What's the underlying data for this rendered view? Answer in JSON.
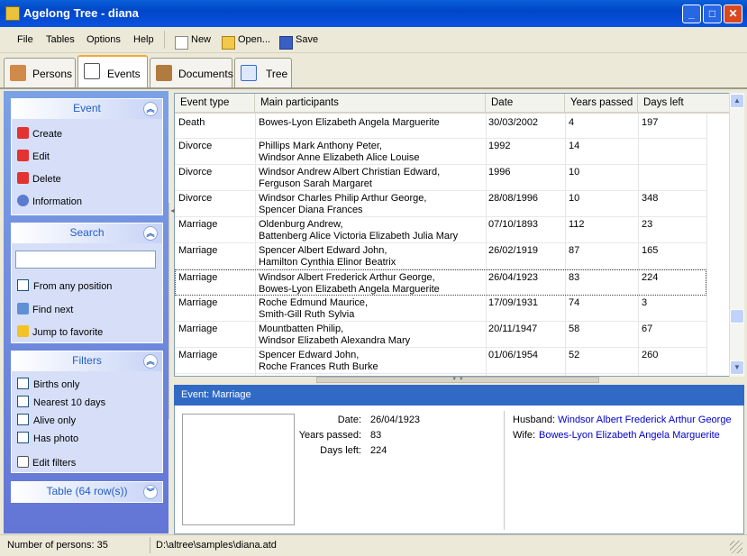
{
  "window": {
    "title": "Agelong Tree - diana",
    "minimize": "_",
    "maximize": "□",
    "close": "✕"
  },
  "menu": {
    "file": "File",
    "tables": "Tables",
    "options": "Options",
    "help": "Help"
  },
  "toolbar": {
    "new": "New",
    "open": "Open...",
    "save": "Save"
  },
  "tabs": {
    "persons": "Persons",
    "events": "Events",
    "documents": "Documents",
    "tree": "Tree"
  },
  "sidebar": {
    "event": {
      "title": "Event",
      "create": "Create",
      "edit": "Edit",
      "delete": "Delete",
      "information": "Information"
    },
    "search": {
      "title": "Search",
      "input_value": "",
      "from_any_position": "From any position",
      "find_next": "Find next",
      "jump_to_favorite": "Jump to favorite"
    },
    "filters": {
      "title": "Filters",
      "births_only": "Births only",
      "nearest_10_days": "Nearest 10 days",
      "alive_only": "Alive only",
      "has_photo": "Has photo",
      "edit_filters": "Edit filters"
    },
    "table": {
      "title": "Table (64 row(s))"
    }
  },
  "grid": {
    "columns": [
      "Event type",
      "Main participants",
      "Date",
      "Years passed",
      "Days left"
    ],
    "rows": [
      {
        "type": "Death",
        "p1": "Bowes-Lyon Elizabeth Angela Marguerite",
        "p2": "",
        "date": "30/03/2002",
        "years": "4",
        "days": "197"
      },
      {
        "type": "Divorce",
        "p1": "Phillips Mark Anthony Peter,",
        "p2": "Windsor Anne Elizabeth Alice Louise",
        "date": "1992",
        "years": "14",
        "days": ""
      },
      {
        "type": "Divorce",
        "p1": "Windsor Andrew Albert Christian Edward,",
        "p2": "Ferguson Sarah Margaret",
        "date": "1996",
        "years": "10",
        "days": ""
      },
      {
        "type": "Divorce",
        "p1": "Windsor Charles Philip Arthur George,",
        "p2": "Spencer Diana Frances",
        "date": "28/08/1996",
        "years": "10",
        "days": "348"
      },
      {
        "type": "Marriage",
        "p1": "Oldenburg Andrew,",
        "p2": "Battenberg Alice Victoria Elizabeth Julia Mary",
        "date": "07/10/1893",
        "years": "112",
        "days": "23"
      },
      {
        "type": "Marriage",
        "p1": "Spencer Albert Edward John,",
        "p2": "Hamilton Cynthia Elinor Beatrix",
        "date": "26/02/1919",
        "years": "87",
        "days": "165"
      },
      {
        "type": "Marriage",
        "p1": "Windsor Albert Frederick Arthur George,",
        "p2": "Bowes-Lyon Elizabeth Angela Marguerite",
        "date": "26/04/1923",
        "years": "83",
        "days": "224"
      },
      {
        "type": "Marriage",
        "p1": "Roche Edmund Maurice,",
        "p2": "Smith-Gill Ruth Sylvia",
        "date": "17/09/1931",
        "years": "74",
        "days": "3"
      },
      {
        "type": "Marriage",
        "p1": "Mountbatten Philip,",
        "p2": "Windsor Elizabeth Alexandra Mary",
        "date": "20/11/1947",
        "years": "58",
        "days": "67"
      },
      {
        "type": "Marriage",
        "p1": "Spencer Edward John,",
        "p2": "Roche Frances Ruth Burke",
        "date": "01/06/1954",
        "years": "52",
        "days": "260"
      }
    ]
  },
  "detail": {
    "header": "Event: Marriage",
    "date_label": "Date:",
    "date": "26/04/1923",
    "years_label": "Years passed:",
    "years": "83",
    "days_label": "Days left:",
    "days": "224",
    "husband_label": "Husband:",
    "husband": "Windsor Albert Frederick Arthur George",
    "wife_label": "Wife:",
    "wife": "Bowes-Lyon Elizabeth Angela Marguerite"
  },
  "status": {
    "persons": "Number of persons: 35",
    "path": "D:\\altree\\samples\\diana.atd"
  }
}
